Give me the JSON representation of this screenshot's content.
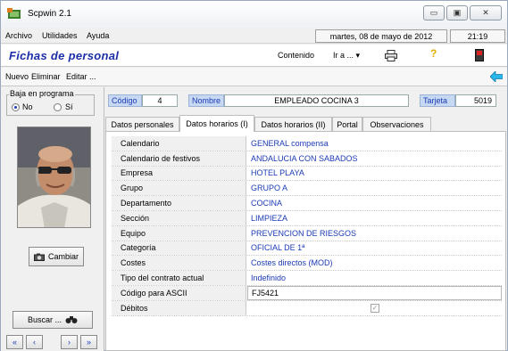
{
  "window": {
    "title": "Scpwin 2.1",
    "controls": {
      "minimize": "▭",
      "maximize": "▣",
      "close": "✕"
    }
  },
  "menu": {
    "items": [
      "Archivo",
      "Utilidades",
      "Ayuda"
    ],
    "date": "martes, 08 de mayo de 2012",
    "time": "21:19"
  },
  "header": {
    "title": "Fichas de personal",
    "contenido": "Contenido",
    "ira": "Ir a ...",
    "ira_arrow": "▾",
    "print_icon": "printer-icon",
    "help_glyph": "?",
    "exit_icon": "exit-icon"
  },
  "toolbar": {
    "items": [
      "Nuevo",
      "Eliminar",
      "Editar ..."
    ],
    "back_icon": "arrow-left-icon"
  },
  "left": {
    "group_label": "Baja en programa",
    "radio_no": "No",
    "radio_si": "Sí",
    "selected": "No",
    "cambiar_label": "Cambiar",
    "buscar_label": "Buscar ...",
    "nav": [
      "«",
      "‹",
      "›",
      "»"
    ]
  },
  "record": {
    "codigo_label": "Código",
    "codigo_value": "4",
    "nombre_label": "Nombre",
    "nombre_value": "EMPLEADO COCINA 3",
    "tarjeta_label": "Tarjeta",
    "tarjeta_value": "5019"
  },
  "tabs": [
    {
      "label": "Datos personales",
      "active": false
    },
    {
      "label": "Datos horarios (I)",
      "active": true
    },
    {
      "label": "Datos horarios (II)",
      "active": false
    },
    {
      "label": "Portal",
      "active": false
    },
    {
      "label": "Observaciones",
      "active": false
    }
  ],
  "fields": [
    {
      "label": "Calendario",
      "value": "GENERAL compensa"
    },
    {
      "label": "Calendario de festivos",
      "value": "ANDALUCIA CON SABADOS"
    },
    {
      "label": "Empresa",
      "value": "HOTEL PLAYA"
    },
    {
      "label": "Grupo",
      "value": "GRUPO A"
    },
    {
      "label": "Departamento",
      "value": "COCINA"
    },
    {
      "label": "Sección",
      "value": "LIMPIEZA"
    },
    {
      "label": "Equipo",
      "value": "PREVENCION DE RIESGOS"
    },
    {
      "label": "Categoría",
      "value": "OFICIAL DE 1ª"
    },
    {
      "label": "Costes",
      "value": "Costes directos (MOD)"
    },
    {
      "label": "Tipo del contrato actual",
      "value": "Indefinido"
    },
    {
      "label": "Código para ASCII",
      "value": "FJ5421"
    },
    {
      "label": "Débitos",
      "value": "",
      "checked": true,
      "check_glyph": "✓"
    }
  ],
  "colors": {
    "accent_blue": "#1b3bb5",
    "label_bg": "#c7d8f3",
    "title_blue": "#1c2fa8"
  }
}
